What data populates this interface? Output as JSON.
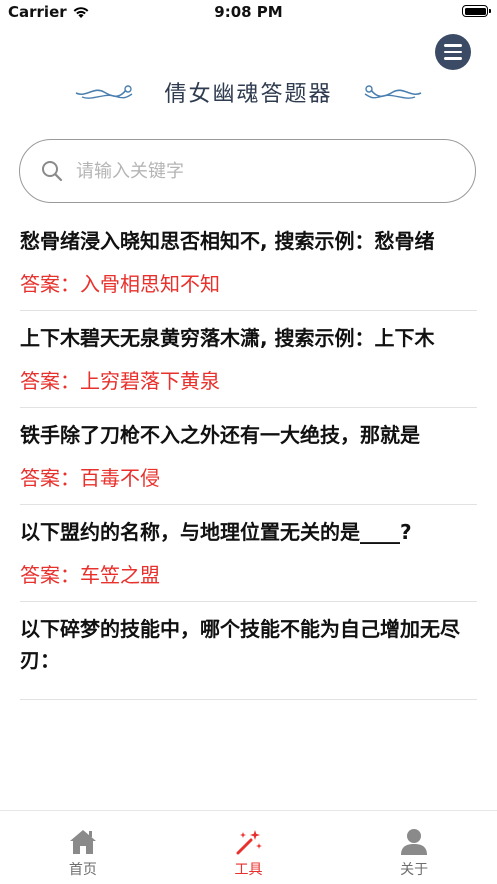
{
  "status_bar": {
    "carrier": "Carrier",
    "time": "9:08 PM"
  },
  "header": {
    "title": "倩女幽魂答题器",
    "menu_icon": "hamburger-menu-icon"
  },
  "search": {
    "placeholder": "请输入关键字",
    "value": ""
  },
  "qa_items": [
    {
      "question": "愁骨绪浸入晓知思否相知不, 搜索示例：愁骨绪",
      "answer": "答案：入骨相思知不知"
    },
    {
      "question": "上下木碧天无泉黄穷落木潇, 搜索示例：上下木",
      "answer": "答案：上穷碧落下黄泉"
    },
    {
      "question": "铁手除了刀枪不入之外还有一大绝技，那就是",
      "answer": "答案：百毒不侵"
    },
    {
      "question": "以下盟约的名称，与地理位置无关的是____?",
      "answer": "答案：车笠之盟"
    },
    {
      "question": "以下碎梦的技能中，哪个技能不能为自己增加无尽刃：",
      "answer": ""
    }
  ],
  "tabs": [
    {
      "label": "首页",
      "icon": "home-icon",
      "active": false
    },
    {
      "label": "工具",
      "icon": "magic-wand-icon",
      "active": true
    },
    {
      "label": "关于",
      "icon": "user-icon",
      "active": false
    }
  ],
  "colors": {
    "accent": "#e8302c",
    "menu_button": "#3b4b66",
    "flourish": "#4a7fb0",
    "tab_inactive": "#6e6e6e"
  }
}
